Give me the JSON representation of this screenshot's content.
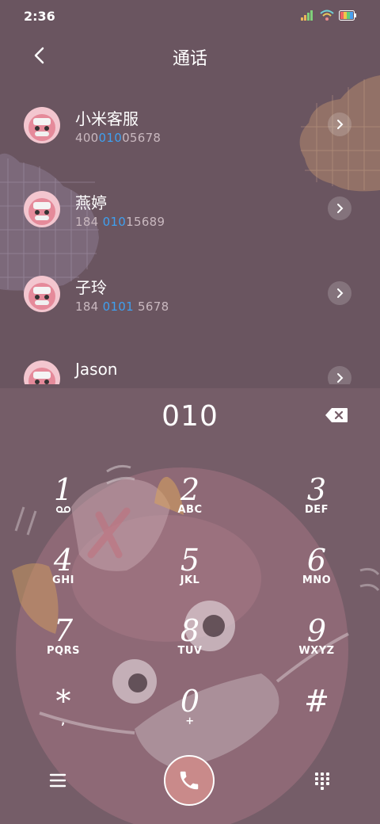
{
  "status_bar": {
    "time": "2:36",
    "icons": [
      "signal-icon",
      "wifi-icon",
      "battery-icon"
    ]
  },
  "header": {
    "title": "通话",
    "back_icon": "back-arrow-icon"
  },
  "contacts": [
    {
      "name": "小米客服",
      "number_parts": [
        "400",
        "010",
        "05678"
      ]
    },
    {
      "name": "燕婷",
      "number_parts": [
        "184 ",
        "010",
        "15689"
      ]
    },
    {
      "name": "子玲",
      "number_parts": [
        "184 ",
        "0101",
        " 5678"
      ]
    },
    {
      "name": "Jason",
      "number_parts": [
        "",
        "",
        ""
      ]
    }
  ],
  "dialer": {
    "input": "010",
    "backspace_icon": "backspace-icon"
  },
  "keypad": [
    {
      "digit": "1",
      "letters": "",
      "sub_icon": "voicemail-icon"
    },
    {
      "digit": "2",
      "letters": "ABC"
    },
    {
      "digit": "3",
      "letters": "DEF"
    },
    {
      "digit": "4",
      "letters": "GHI"
    },
    {
      "digit": "5",
      "letters": "JKL"
    },
    {
      "digit": "6",
      "letters": "MNO"
    },
    {
      "digit": "7",
      "letters": "PQRS"
    },
    {
      "digit": "8",
      "letters": "TUV"
    },
    {
      "digit": "9",
      "letters": "WXYZ"
    },
    {
      "digit": "*",
      "letters": ","
    },
    {
      "digit": "0",
      "letters": "+"
    },
    {
      "digit": "#",
      "letters": ""
    }
  ],
  "bottom_bar": {
    "menu_icon": "menu-icon",
    "call_icon": "phone-icon",
    "keypad_icon": "keypad-icon"
  },
  "colors": {
    "highlight": "#3ea0f0",
    "call_button": "#c98a8a",
    "background": "#6b5660"
  }
}
